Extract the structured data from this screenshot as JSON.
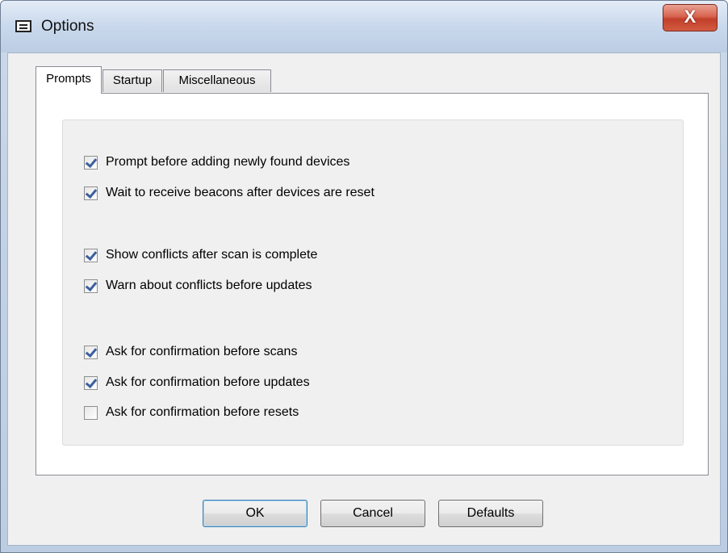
{
  "window": {
    "title": "Options",
    "close_label": "X"
  },
  "tabs": [
    {
      "label": "Prompts",
      "active": true
    },
    {
      "label": "Startup",
      "active": false
    },
    {
      "label": "Miscellaneous",
      "active": false
    }
  ],
  "options": [
    {
      "label": "Prompt before adding newly found devices",
      "checked": true
    },
    {
      "label": "Wait to receive beacons after devices are reset",
      "checked": true
    },
    {
      "label": "Show conflicts after scan is complete",
      "checked": true
    },
    {
      "label": "Warn about conflicts before updates",
      "checked": true
    },
    {
      "label": "Ask for confirmation before scans",
      "checked": true
    },
    {
      "label": "Ask for confirmation before updates",
      "checked": true
    },
    {
      "label": "Ask for confirmation before resets",
      "checked": false
    }
  ],
  "buttons": {
    "ok": "OK",
    "cancel": "Cancel",
    "defaults": "Defaults"
  }
}
